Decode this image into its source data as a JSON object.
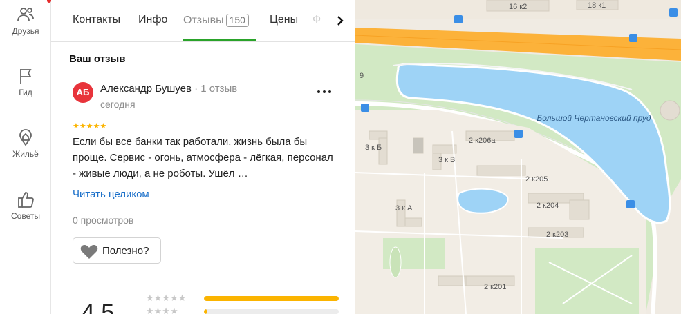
{
  "sidebar": {
    "items": [
      {
        "label": "Друзья",
        "icon": "friends-icon"
      },
      {
        "label": "Гид",
        "icon": "flag-icon"
      },
      {
        "label": "Жильё",
        "icon": "housing-icon"
      },
      {
        "label": "Советы",
        "icon": "thumbs-up-icon"
      }
    ]
  },
  "tabs": {
    "items": [
      {
        "label": "Контакты"
      },
      {
        "label": "Инфо"
      },
      {
        "label": "Отзывы",
        "count": "150"
      },
      {
        "label": "Цены"
      }
    ],
    "faded": "Ф",
    "active_index": 2
  },
  "review_section": {
    "title": "Ваш отзыв"
  },
  "review": {
    "avatar_initials": "АБ",
    "author": "Александр Бушуев",
    "author_meta": " · 1 отзыв",
    "date": "сегодня",
    "stars": "★★★★★",
    "text": "Если бы все банки так работали, жизнь была бы проще. Сервис - огонь, атмосфера - лёгкая, персонал - живые люди, а не роботы. Ушёл …",
    "read_more": "Читать целиком",
    "views": "0 просмотров",
    "useful_label": "Полезно?"
  },
  "rating": {
    "value": "4,5",
    "distribution": [
      {
        "stars": "★★★★★",
        "fraction": 1.0
      },
      {
        "stars": "★★★★",
        "fraction": 0.02
      }
    ]
  },
  "map": {
    "labels": [
      "16 к2",
      "18 к1",
      "9",
      "3 к Б",
      "3 к В",
      "3 к А",
      "2 к206а",
      "2 к205",
      "2 к204",
      "2 к203",
      "2 к201"
    ],
    "pond_name": "Большой Чертановский пруд",
    "colors": {
      "road": "#fcb23a",
      "water": "#9ed3f6",
      "park": "#cfe8c2",
      "ground": "#f0ebe3"
    }
  },
  "colors": {
    "accent_green": "#2aa32a",
    "link": "#1a6fc9",
    "avatar": "#e8343b",
    "star": "#fbb400"
  }
}
